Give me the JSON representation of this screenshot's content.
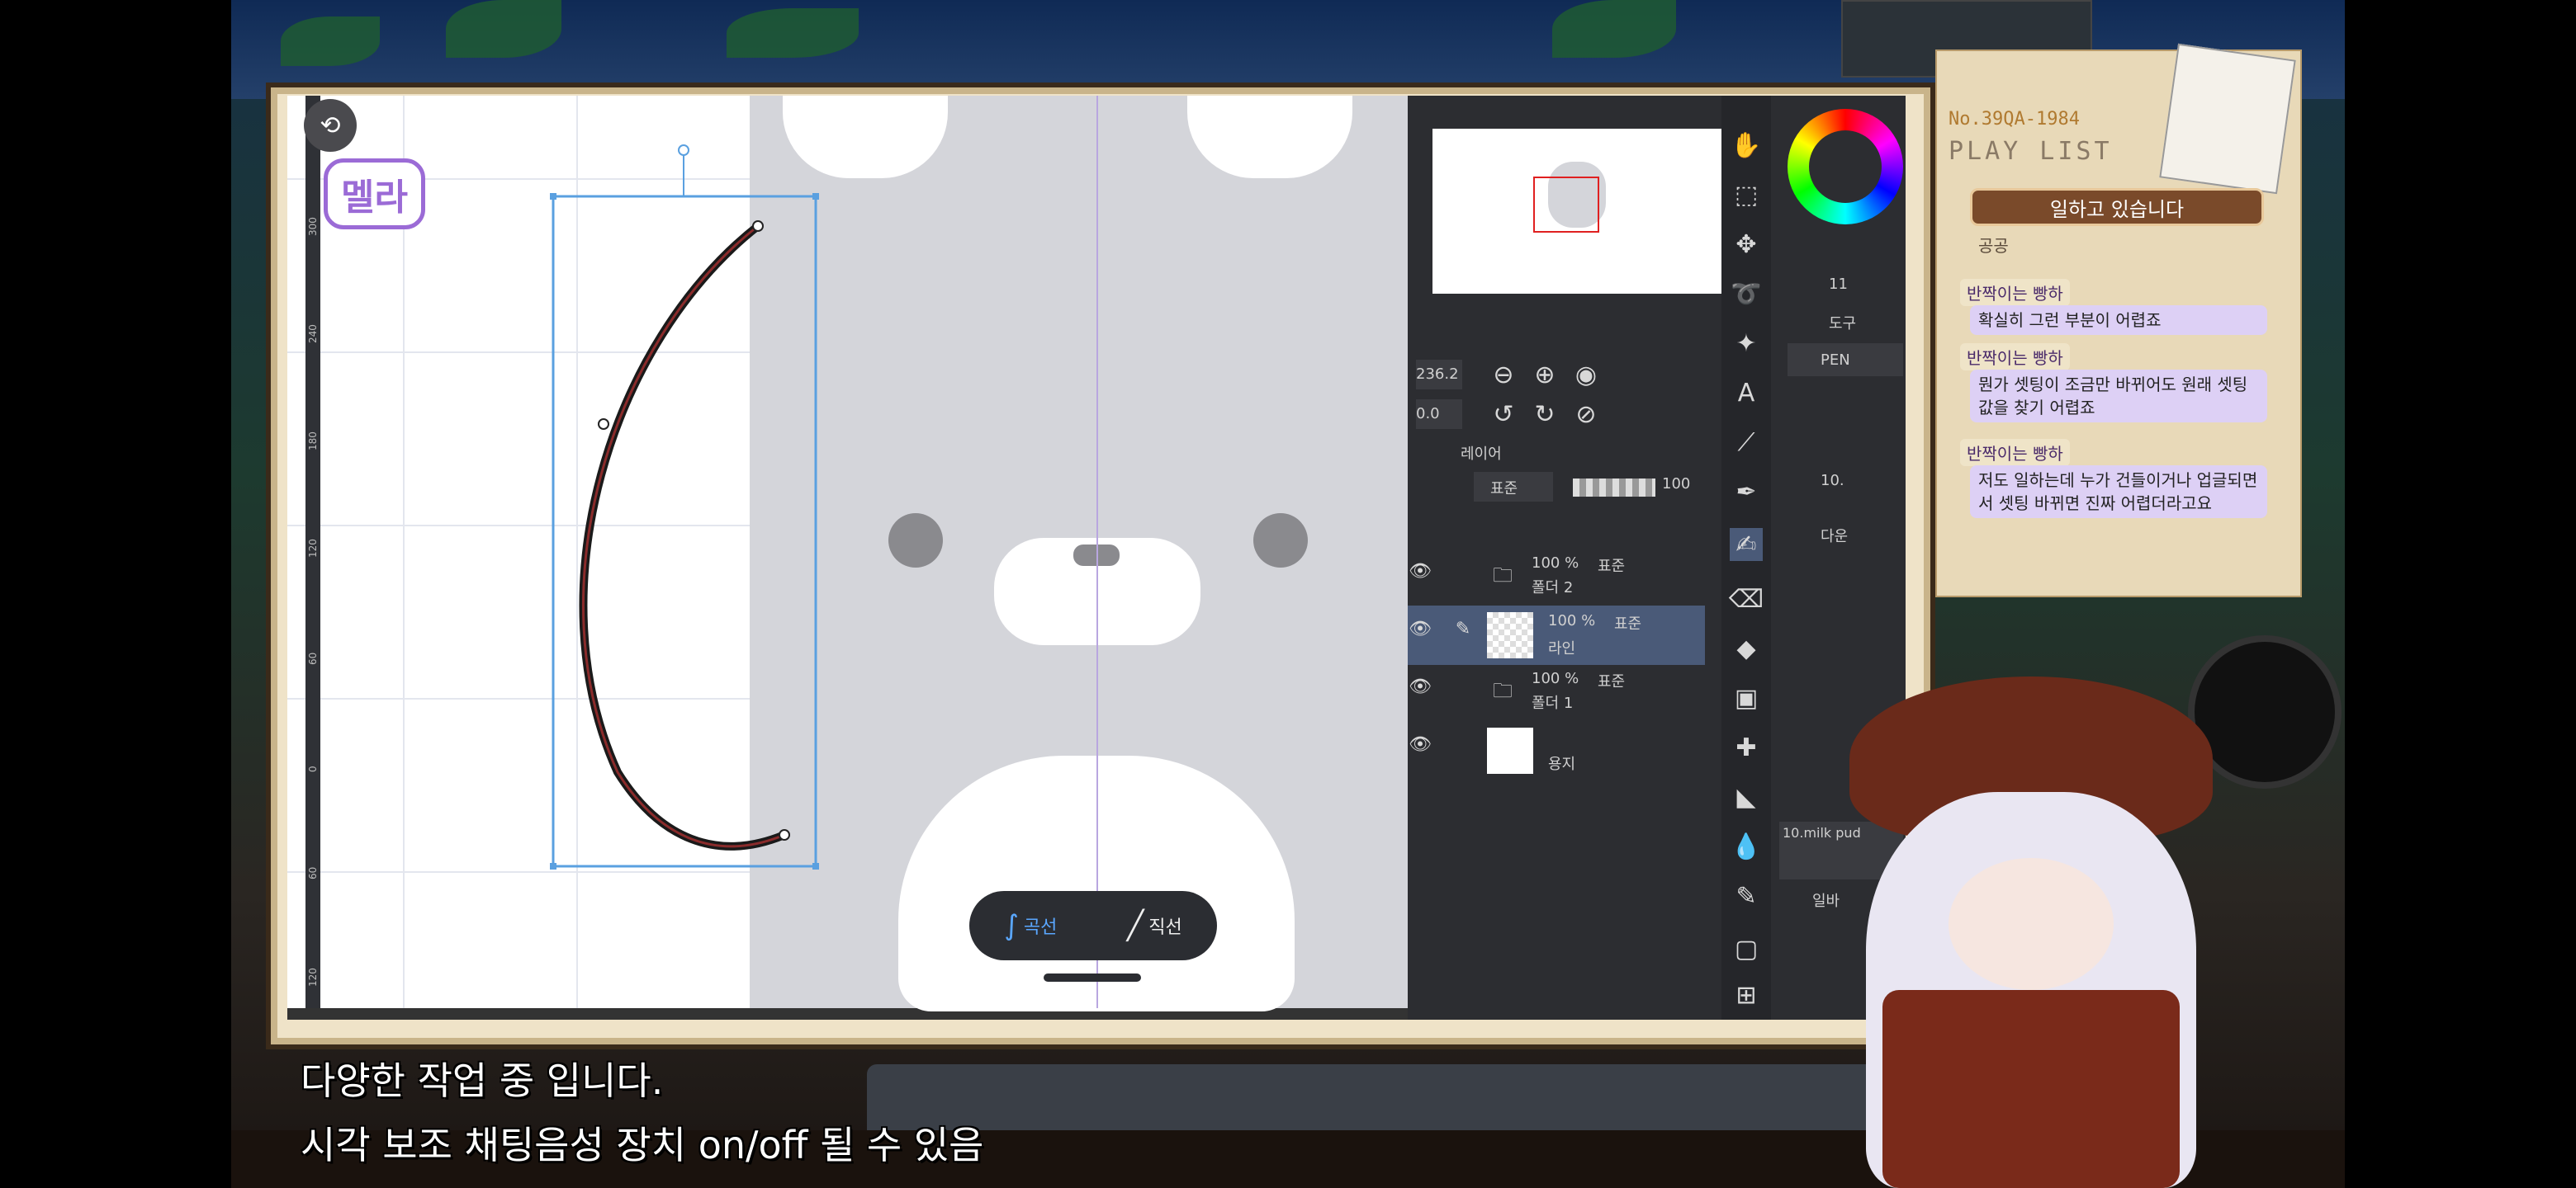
{
  "logo_text": "멜라",
  "app": {
    "curve_toolbar": {
      "curve_label": "곡선",
      "line_label": "직선"
    },
    "ruler_labels": [
      "300",
      "240",
      "180",
      "120",
      "60",
      "0",
      "60",
      "120"
    ],
    "navigator": {
      "zoom_value": "236.2",
      "rotation_value": "0.0"
    },
    "layer_panel": {
      "title": "레이어",
      "blend_mode": "표준",
      "opacity": "100",
      "layers": [
        {
          "opacity": "100 %",
          "mode": "표준",
          "name": "폴더 2"
        },
        {
          "opacity": "100 %",
          "mode": "표준",
          "name": "라인"
        },
        {
          "opacity": "100 %",
          "mode": "표준",
          "name": "폴더 1"
        },
        {
          "opacity": "",
          "mode": "",
          "name": "용지"
        }
      ]
    },
    "side_panel": {
      "tool_tab": "도구",
      "pen_label": "PEN",
      "brush_size": "10.",
      "brush_name": "10.milk pud",
      "add_label": "다운",
      "checkbox_label": "일바",
      "color_value": "11"
    }
  },
  "playlist": {
    "header_code": "No.39QA-1984",
    "header_title": "PLAY LIST",
    "status": "일하고 있습니다",
    "messages": [
      {
        "user": "",
        "text": "공공"
      },
      {
        "user": "반짝이는 빵하",
        "text": "확실히 그런 부분이 어렵죠"
      },
      {
        "user": "반짝이는 빵하",
        "text": "뭔가 셋팅이 조금만 바뀌어도 원래 셋팅값을 찾기 어렵죠"
      },
      {
        "user": "반짝이는 빵하",
        "text": "저도 일하는데 누가 건들이거나 업글되면서 셋팅 바뀌면 진짜 어렵더라고요"
      }
    ]
  },
  "subtitles": {
    "line1": "다양한 작업 중 입니다.",
    "line2": "시각 보조 채팅음성 장치 on/off 될 수 있음"
  },
  "colors": {
    "accent": "#3b7fd9",
    "bubble": "#ddd0f5",
    "panel": "#2c2d31"
  }
}
